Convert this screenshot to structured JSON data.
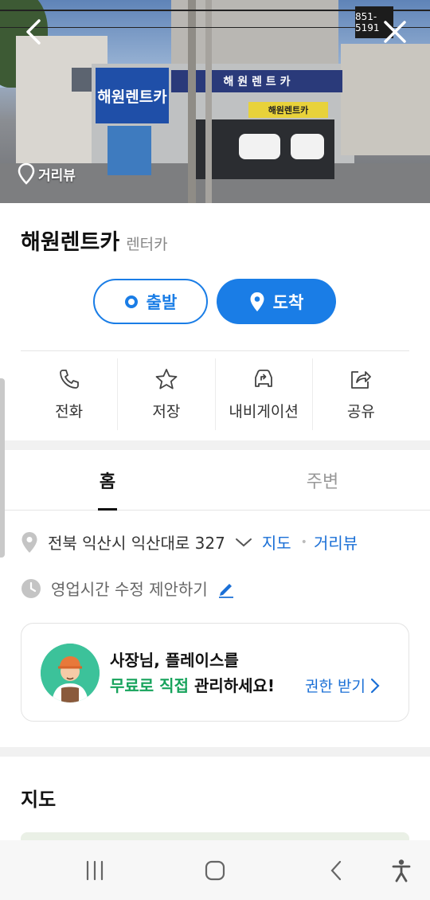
{
  "hero": {
    "streetview_label": "거리뷰",
    "shop_sign": "해원렌트카",
    "shop_strip_sign": "해 원 렌 트 카",
    "shop_yellow_sign": "해원렌트카",
    "number_sign": "851-5191",
    "back_icon": "chevron-left-icon",
    "close_icon": "close-icon"
  },
  "place": {
    "name": "해원렌트카",
    "category": "렌터카"
  },
  "route": {
    "start_label": "출발",
    "arrive_label": "도착"
  },
  "quick_actions": [
    {
      "label": "전화",
      "icon": "phone-icon"
    },
    {
      "label": "저장",
      "icon": "star-icon"
    },
    {
      "label": "내비게이션",
      "icon": "car-navigation-icon"
    },
    {
      "label": "공유",
      "icon": "share-icon"
    }
  ],
  "tabs": [
    {
      "label": "홈",
      "active": true
    },
    {
      "label": "주변",
      "active": false
    }
  ],
  "address": {
    "text": "전북 익산시 익산대로 327",
    "map_link": "지도",
    "streetview_link": "거리뷰"
  },
  "hours": {
    "text": "영업시간 수정 제안하기"
  },
  "owner_card": {
    "line1": "사장님, 플레이스를",
    "line2_highlight": "무료로 직접",
    "line2_rest": "관리하세요!",
    "cta": "권한 받기"
  },
  "map_section": {
    "title": "지도"
  },
  "colors": {
    "accent": "#1a7de6",
    "link": "#1a6fd6",
    "highlight_green": "#17a35c"
  }
}
